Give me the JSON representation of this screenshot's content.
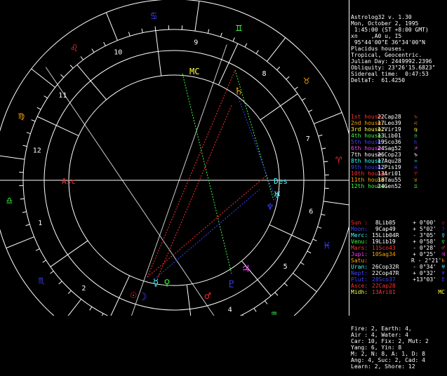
{
  "header": {
    "lines": [
      "Astrolog32 v. 1.30",
      "Mon, October 2, 1995",
      " 1:45:00 (ST +8:00 GMT)",
      "xn    ,A0 u, I5",
      " 95°44'00\"E 36°34'00\"N",
      "Placidus houses.",
      "Tropical, Geocentric.",
      "Julian Day: 2449992.2396",
      "Obliquity: 23°26'15.6823\"",
      "Sidereal time:  0:47:53",
      "DeltaT:  61.4250"
    ]
  },
  "houses": [
    {
      "label": "1st house:",
      "value": "22Cap28",
      "glyph": "♑",
      "color": "#ff3030"
    },
    {
      "label": "2nd house:",
      "value": "17Leo39",
      "glyph": "♌",
      "color": "#ffa500"
    },
    {
      "label": "3rd house:",
      "value": "12Vir19",
      "glyph": "♍",
      "color": "#ffff40"
    },
    {
      "label": "4th house:",
      "value": "13Lib01",
      "glyph": "♎",
      "color": "#40ff40"
    },
    {
      "label": "5th house:",
      "value": "19Sco36",
      "glyph": "♏",
      "color": "#4040ff"
    },
    {
      "label": "6th house:",
      "value": "24Sag52",
      "glyph": "♐",
      "color": "#ff40ff"
    },
    {
      "label": "7th house:",
      "value": "26Cop23",
      "glyph": "♑",
      "color": "#ffffff"
    },
    {
      "label": "8th house:",
      "value": "17Aqu28",
      "glyph": "♒",
      "color": "#40ffff"
    },
    {
      "label": "9th house:",
      "value": "12Pis19",
      "glyph": "♓",
      "color": "#4040ff"
    },
    {
      "label": "10th house:",
      "value": "13Ari01",
      "glyph": "♈",
      "color": "#ff3030"
    },
    {
      "label": "11th house:",
      "value": "18Tau55",
      "glyph": "♉",
      "color": "#ffa500"
    },
    {
      "label": "12th house:",
      "value": "24Gen52",
      "glyph": "♊",
      "color": "#40ff40"
    }
  ],
  "planets": [
    {
      "label": "Sun :",
      "pos": " 8Lib05",
      "decl": "+ 0°00'",
      "glyph": "☉",
      "color": "#ff3030",
      "vcolor": "#ffffff"
    },
    {
      "label": "Moon:",
      "pos": " 9Cap49",
      "decl": "+ 5°02'",
      "glyph": "☽",
      "color": "#4040ff",
      "vcolor": "#ffffff"
    },
    {
      "label": "Merc:",
      "pos": "15Lib04R",
      "decl": "- 3°05'",
      "glyph": "☿",
      "color": "#40ffff",
      "vcolor": "#ffffff"
    },
    {
      "label": "Venu:",
      "pos": "19Lib19",
      "decl": "+ 0°58'",
      "glyph": "♀",
      "color": "#40ff40",
      "vcolor": "#ffffff"
    },
    {
      "label": "Mars:",
      "pos": "11Sco43",
      "decl": "- 0°28'",
      "glyph": "♂",
      "color": "#ff3030",
      "vcolor": "#ff3030"
    },
    {
      "label": "Jupi:",
      "pos": "10Sag34",
      "decl": "+ 0°25'",
      "glyph": "♃",
      "color": "#ff40ff",
      "vcolor": "#ffa500"
    },
    {
      "label": "Satu:",
      "pos": "",
      "decl": "R - 2°21'",
      "glyph": "♄",
      "color": "#ffa500",
      "vcolor": "#ffffff"
    },
    {
      "label": "Uran:",
      "pos": "26Cop32R",
      "decl": "- 0°34'",
      "glyph": "♅",
      "color": "#40ffff",
      "vcolor": "#ffffff"
    },
    {
      "label": "Nept:",
      "pos": "22Cop47R",
      "decl": "+ 0°32'",
      "glyph": "♆",
      "color": "#4040ff",
      "vcolor": "#ffffff"
    },
    {
      "label": "Plut:",
      "pos": "28Sco37",
      "decl": "+13°03'",
      "glyph": "♇",
      "color": "#4040ff",
      "vcolor": "#4040ff"
    },
    {
      "label": "Asce:",
      "pos": "22Cap28",
      "decl": "",
      "glyph": "",
      "color": "#ff3030",
      "vcolor": "#ff3030"
    },
    {
      "label": "Midh:",
      "pos": "13Ari01",
      "decl": "",
      "glyph": "MC",
      "color": "#ffff40",
      "vcolor": "#ff3030"
    }
  ],
  "summary": [
    "Fire: 2, Earth: 4,",
    "Air : 4, Water: 4",
    "Car: 10, Fix: 2, Mut: 2",
    "Yang: 6, Yin: 8",
    "M: 2, N: 8, A: 1, D: 8",
    "Ang: 4, Suc: 2, Cad: 4",
    "Learn: 2, Shore: 12"
  ],
  "wheel": {
    "asc_label": "Asc",
    "des_label": "Des",
    "mc_label": "MC",
    "house_numbers": [
      "1",
      "2",
      "3",
      "4",
      "5",
      "6",
      "7",
      "8",
      "9",
      "10",
      "11",
      "12"
    ],
    "sign_glyphs": [
      "♈",
      "♉",
      "♊",
      "♋",
      "♌",
      "♍",
      "♎",
      "♏",
      "♐",
      "♑",
      "♒",
      "♓"
    ],
    "sign_colors": [
      "#ff3030",
      "#ffa500",
      "#40ff40",
      "#4040ff",
      "#ff3030",
      "#ffa500",
      "#40ff40",
      "#4040ff",
      "#ff3030",
      "#ffa500",
      "#40ff40",
      "#4040ff"
    ],
    "wheel_planets": [
      {
        "glyph": "☉",
        "color": "#ff3030",
        "name": "sun"
      },
      {
        "glyph": "☽",
        "color": "#4040ff",
        "name": "moon"
      },
      {
        "glyph": "☿",
        "color": "#40ffff",
        "name": "mercury"
      },
      {
        "glyph": "♀",
        "color": "#40ff40",
        "name": "venus"
      },
      {
        "glyph": "♂",
        "color": "#ff3030",
        "name": "mars"
      },
      {
        "glyph": "♃",
        "color": "#ff40ff",
        "name": "jupiter"
      },
      {
        "glyph": "♄",
        "color": "#ffa500",
        "name": "saturn"
      },
      {
        "glyph": "♅",
        "color": "#40ffff",
        "name": "uranus"
      },
      {
        "glyph": "♆",
        "color": "#4040ff",
        "name": "neptune"
      },
      {
        "glyph": "♇",
        "color": "#4040ff",
        "name": "pluto"
      }
    ]
  }
}
